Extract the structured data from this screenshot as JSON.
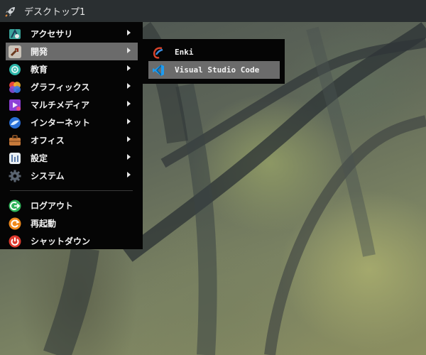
{
  "panel": {
    "title": "デスクトップ1",
    "launcher_icon": "rocket-icon"
  },
  "menu": {
    "items": [
      {
        "label": "アクセサリ",
        "icon": "accessories-icon",
        "has_submenu": true
      },
      {
        "label": "開発",
        "icon": "development-icon",
        "has_submenu": true,
        "active": true
      },
      {
        "label": "教育",
        "icon": "education-icon",
        "has_submenu": true
      },
      {
        "label": "グラフィックス",
        "icon": "graphics-icon",
        "has_submenu": true
      },
      {
        "label": "マルチメディア",
        "icon": "multimedia-icon",
        "has_submenu": true
      },
      {
        "label": "インターネット",
        "icon": "internet-icon",
        "has_submenu": true
      },
      {
        "label": "オフィス",
        "icon": "office-icon",
        "has_submenu": true
      },
      {
        "label": "設定",
        "icon": "settings-icon",
        "has_submenu": true
      },
      {
        "label": "システム",
        "icon": "system-icon",
        "has_submenu": true
      }
    ],
    "session_items": [
      {
        "label": "ログアウト",
        "icon": "logout-icon"
      },
      {
        "label": "再起動",
        "icon": "restart-icon"
      },
      {
        "label": "シャットダウン",
        "icon": "shutdown-icon"
      }
    ]
  },
  "submenu": {
    "items": [
      {
        "label": "Enki",
        "icon": "enki-icon"
      },
      {
        "label": "Visual Studio Code",
        "icon": "vscode-icon",
        "active": true
      }
    ]
  },
  "colors": {
    "menu_bg": "#050505",
    "highlight": "#6b6b6b",
    "panel_bg": "#2a2f31",
    "text": "#f2f2f2"
  }
}
